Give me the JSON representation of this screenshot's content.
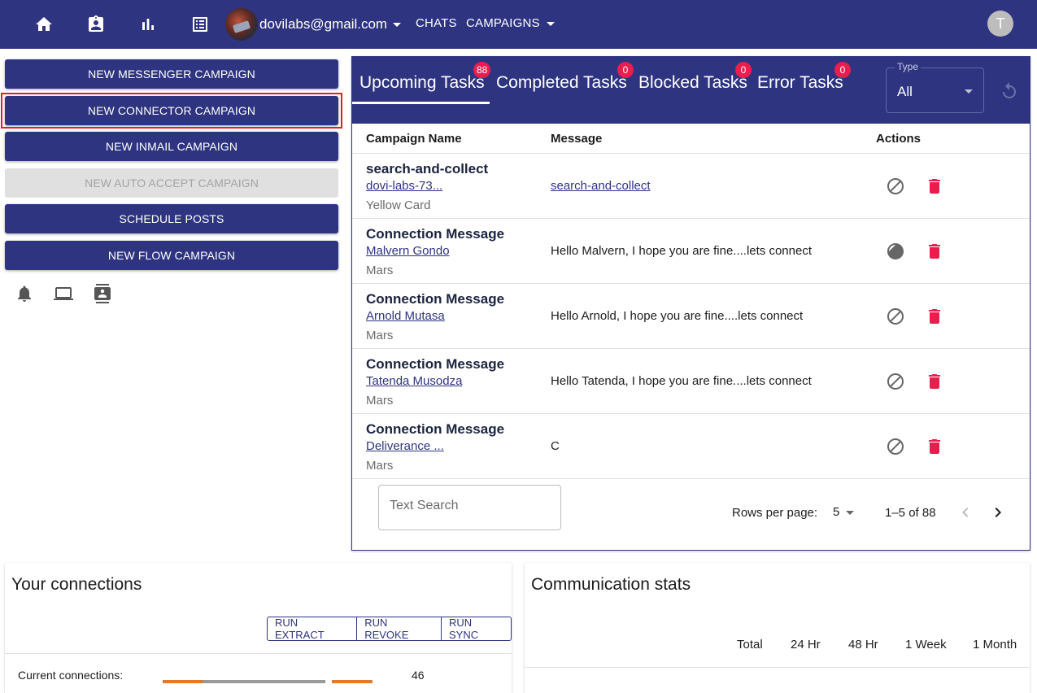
{
  "header": {
    "account_email": "dovilabs@gmail.com",
    "nav_chats": "CHATS",
    "nav_campaigns": "CAMPAIGNS",
    "user_initial": "T",
    "nav_icons": [
      "home-icon",
      "assignment-ind-icon",
      "bar-chart-icon",
      "list-alt-icon"
    ]
  },
  "sidebar": {
    "buttons": [
      {
        "label": "NEW MESSENGER CAMPAIGN",
        "enabled": true
      },
      {
        "label": "NEW CONNECTOR CAMPAIGN",
        "enabled": true
      },
      {
        "label": "NEW INMAIL CAMPAIGN",
        "enabled": true
      },
      {
        "label": "NEW AUTO ACCEPT CAMPAIGN",
        "enabled": false
      },
      {
        "label": "SCHEDULE POSTS",
        "enabled": true
      },
      {
        "label": "NEW FLOW CAMPAIGN",
        "enabled": true
      }
    ],
    "icons": [
      "notifications-icon",
      "laptop-icon",
      "contacts-icon"
    ]
  },
  "tasks": {
    "tabs": [
      {
        "label": "Upcoming Tasks",
        "count": "88",
        "active": true
      },
      {
        "label": "Completed Tasks",
        "count": "0",
        "active": false
      },
      {
        "label": "Blocked Tasks",
        "count": "0",
        "active": false
      },
      {
        "label": "Error Tasks",
        "count": "0",
        "active": false
      }
    ],
    "type_filter": {
      "label": "Type",
      "value": "All"
    },
    "columns": {
      "campaign": "Campaign Name",
      "message": "Message",
      "actions": "Actions"
    },
    "rows": [
      {
        "title": "search-and-collect",
        "link": "dovi-labs-73...",
        "sub": "Yellow Card",
        "message": "search-and-collect"
      },
      {
        "title": "Connection Message",
        "link": "Malvern Gondo",
        "sub": "Mars",
        "message": "Hello Malvern, I hope you are fine....lets connect"
      },
      {
        "title": "Connection Message",
        "link": "Arnold Mutasa",
        "sub": "Mars",
        "message": "Hello Arnold, I hope you are fine....lets connect"
      },
      {
        "title": "Connection Message",
        "link": "Tatenda Musodza",
        "sub": "Mars",
        "message": "Hello Tatenda, I hope you are fine....lets connect"
      },
      {
        "title": "Connection Message",
        "link": "Deliverance ...",
        "sub": "Mars",
        "message": "C"
      }
    ],
    "search_placeholder": "Text Search",
    "pager": {
      "rows_label": "Rows per page:",
      "rows_value": "5",
      "range": "1–5 of 88"
    }
  },
  "connections": {
    "title": "Your connections",
    "buttons": [
      "RUN EXTRACT",
      "RUN REVOKE",
      "RUN SYNC"
    ],
    "current_label": "Current connections:",
    "current_value": "46"
  },
  "stats": {
    "title": "Communication stats",
    "headers": [
      "Total",
      "24 Hr",
      "48 Hr",
      "1 Week",
      "1 Month"
    ]
  },
  "colors": {
    "primary": "#2e3480",
    "badge": "#e91e4e",
    "delete": "#e91e4e",
    "highlight": "#e02020"
  }
}
